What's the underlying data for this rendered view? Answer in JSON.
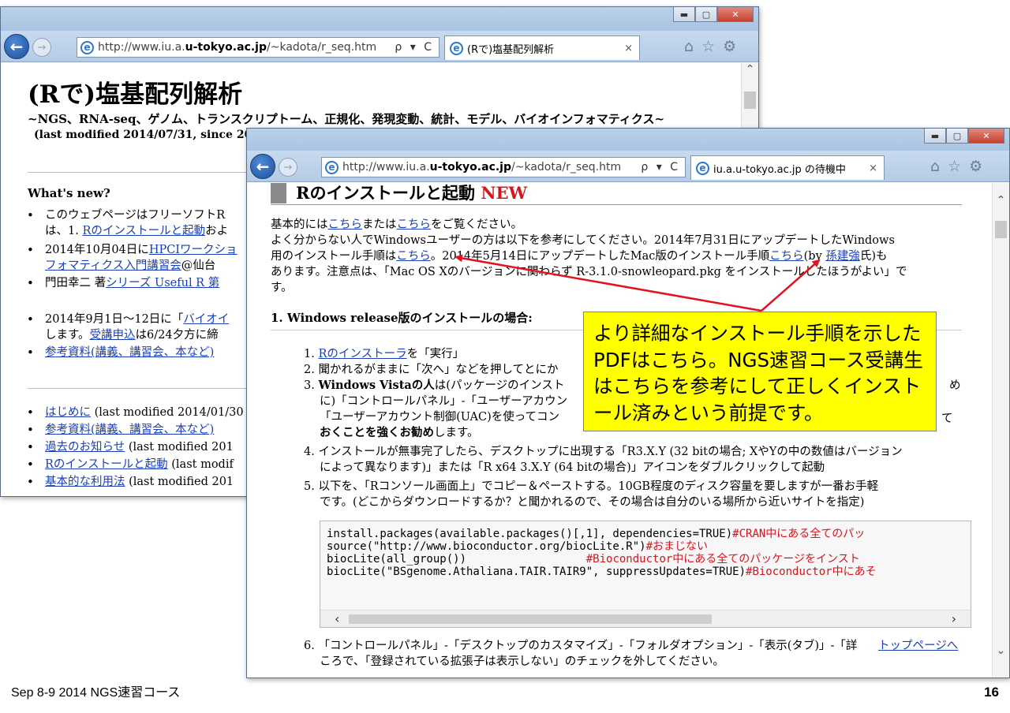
{
  "back_window": {
    "address_pre": "http://www.iu.a.",
    "address_domain": "u-tokyo.ac.jp",
    "address_post": "/~kadota/r_seq.htm",
    "address_tools": "ρ ▾ C",
    "tab_label": "(Rで)塩基配列解析",
    "tab_close": "×",
    "window_buttons": {
      "minimize": "▬",
      "maximize": "▢",
      "close": "✕"
    },
    "page_title": "(Rで)塩基配列解析",
    "subtitle": "~NGS、RNA-seq、ゲノム、トランスクリプトーム、正規化、発現変動、統計、モデル、バイオインフォマティクス~",
    "last_modified": "(last modified 2014/07/31, since 20",
    "whats_new": "What's new?",
    "news": [
      {
        "pre": "このウェブページはフリーソフトR",
        "link": "",
        "post": ""
      },
      {
        "pre": "は、1. ",
        "link": "Rのインストールと起動",
        "post": "およ"
      },
      {
        "pre": "2014年10月04日に",
        "link": "HPCIワークショ",
        "post": ""
      },
      {
        "pre": "",
        "link": "フォマティクス入門講習会",
        "post": "@仙台"
      },
      {
        "pre": "門田幸二 著",
        "link": "シリーズ Useful R 第",
        "post": ""
      },
      {
        "pre": "2014年9月1日～12日に「",
        "link": "バイオイ",
        "post": ""
      },
      {
        "pre": "します。",
        "link": "受講申込",
        "post": "は6/24夕方に締"
      },
      {
        "pre": "",
        "link": "参考資料(講義、講習会、本など)",
        "post": ""
      }
    ],
    "toc": [
      {
        "link": "はじめに",
        "post": " (last modified 2014/01/30"
      },
      {
        "link": "参考資料(講義、講習会、本など)",
        "post": ""
      },
      {
        "link": "過去のお知らせ",
        "post": " (last modified 201"
      },
      {
        "link": "Rのインストールと起動",
        "post": " (last modif"
      },
      {
        "link": "基本的な利用法",
        "post": " (last modified 201"
      }
    ]
  },
  "front_window": {
    "address_pre": "http://www.iu.a.",
    "address_domain": "u-tokyo.ac.jp",
    "address_post": "/~kadota/r_seq.htm",
    "address_tools": "ρ ▾ C",
    "tab_label": "iu.a.u-tokyo.ac.jp の待機中",
    "tab_close": "×",
    "window_buttons": {
      "minimize": "▬",
      "maximize": "▢",
      "close": "✕"
    },
    "section_title": "Rのインストールと起動",
    "section_new": "NEW",
    "intro_line1": {
      "pre": "基本的には",
      "link1": "こちら",
      "mid": "または",
      "link2": "こちら",
      "post": "をご覧ください。"
    },
    "intro_line2": "よく分からない人でWindowsユーザーの方は以下を参考にしてください。2014年7月31日にアップデートしたWindows",
    "intro_line3": {
      "pre": "用のインストール手順は",
      "link1": "こちら",
      "mid": "。2014年5月14日にアップデートしたMac版のインストール手順",
      "link2": "こちら",
      "mid2": "(by ",
      "link3": "孫建強",
      "post": "氏)も"
    },
    "intro_line4": "あります。注意点は、「Mac OS Xのバージョンに関わらず R-3.1.0-snowleopard.pkg をインストールしたほうがよい」で",
    "intro_line5": "す。",
    "sub_heading": "1. Windows release版のインストールの場合:",
    "steps": [
      {
        "num": "1.",
        "link": "Rのインストーラ",
        "text": "を「実行」"
      },
      {
        "num": "2.",
        "text": "聞かれるがままに「次へ」などを押してとにか"
      },
      {
        "num": "3.",
        "text_bold": "Windows Vistaの人",
        "text": "は(パッケージのインスト",
        "tail": "め"
      },
      {
        "num": "",
        "text": "に)「コントロールパネル」-「ユーザーアカウン"
      },
      {
        "num": "",
        "text": "「ユーザーアカウント制御(UAC)を使ってコン",
        "tail": "て"
      },
      {
        "num": "",
        "text_bold": "おくことを強くお勧め",
        "text": "します。"
      },
      {
        "num": "4.",
        "text": "インストールが無事完了したら、デスクトップに出現する「R3.X.Y (32 bitの場合; XやYの中の数値はバージョン"
      },
      {
        "num": "",
        "text": "によって異なります)」または「R x64 3.X.Y (64 bitの場合)」アイコンをダブルクリックして起動"
      },
      {
        "num": "5.",
        "text": "以下を、「Rコンソール画面上」でコピー＆ペーストする。10GB程度のディスク容量を要しますが一番お手軽"
      },
      {
        "num": "",
        "text": "です。(どこからダウンロードするか？と聞かれるので、その場合は自分のいる場所から近いサイトを指定)"
      },
      {
        "num": "6.",
        "text": "「コントロールパネル」-「デスクトップのカスタマイズ」-「フォルダオプション」-「表示(タブ)」-「詳",
        "link": "トップページへ"
      },
      {
        "num": "",
        "text": "ころで、「登録されている拡張子は表示しない」のチェックを外してください。"
      }
    ],
    "code_lines": [
      {
        "code": "install.packages(available.packages()[,1], dependencies=TRUE)",
        "comment": "#CRAN中にある全てのパッ"
      },
      {
        "code": "source(\"http://www.bioconductor.org/biocLite.R\")",
        "comment": "#おまじない"
      },
      {
        "code": "biocLite(all_group())                  ",
        "comment": "#Bioconductor中にある全てのパッケージをインスト"
      },
      {
        "code": "biocLite(\"BSgenome.Athaliana.TAIR.TAIR9\", suppressUpdates=TRUE)",
        "comment": "#Bioconductor中にあそ"
      }
    ]
  },
  "callout_text": "より詳細なインストール手順を示したPDFはこちら。NGS速習コース受講生はこちらを参考にして正しくインストール済みという前提です。",
  "footer_left": "Sep 8-9 2014 NGS速習コース",
  "footer_page": "16",
  "colors": {
    "link": "#1a3fb5",
    "new_label": "#d8141e",
    "callout_bg": "#ffff00",
    "arrow": "#e0141e",
    "ie_chrome": "#b9d1ea"
  }
}
